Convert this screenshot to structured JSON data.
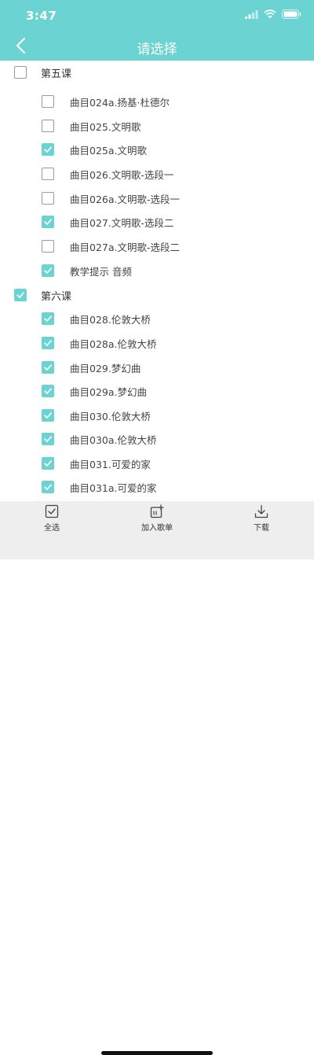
{
  "status_bar": {
    "time": "3:47"
  },
  "nav": {
    "title": "请选择"
  },
  "colors": {
    "accent": "#6cd3d3",
    "toolbar_bg": "#eeeeee"
  },
  "rows": [
    {
      "type": "group",
      "label": "第五课",
      "checked": false
    },
    {
      "type": "item",
      "label": "曲目024a.扬基·杜德尔",
      "checked": false
    },
    {
      "type": "item",
      "label": "曲目025.文明歌",
      "checked": false
    },
    {
      "type": "item",
      "label": "曲目025a.文明歌",
      "checked": true
    },
    {
      "type": "item",
      "label": "曲目026.文明歌-选段一",
      "checked": false
    },
    {
      "type": "item",
      "label": "曲目026a.文明歌-选段一",
      "checked": false
    },
    {
      "type": "item",
      "label": "曲目027.文明歌-选段二",
      "checked": true
    },
    {
      "type": "item",
      "label": "曲目027a.文明歌-选段二",
      "checked": false
    },
    {
      "type": "item",
      "label": "教学提示 音频",
      "checked": true
    },
    {
      "type": "group",
      "label": "第六课",
      "checked": true
    },
    {
      "type": "item",
      "label": "曲目028.伦敦大桥",
      "checked": true
    },
    {
      "type": "item",
      "label": "曲目028a.伦敦大桥",
      "checked": true
    },
    {
      "type": "item",
      "label": "曲目029.梦幻曲",
      "checked": true
    },
    {
      "type": "item",
      "label": "曲目029a.梦幻曲",
      "checked": true
    },
    {
      "type": "item",
      "label": "曲目030.伦敦大桥",
      "checked": true
    },
    {
      "type": "item",
      "label": "曲目030a.伦敦大桥",
      "checked": true
    },
    {
      "type": "item",
      "label": "曲目031.可爱的家",
      "checked": true
    },
    {
      "type": "item",
      "label": "曲目031a.可爱的家",
      "checked": true
    }
  ],
  "toolbar": {
    "select_all": {
      "label": "全选",
      "icon": "select-all-icon"
    },
    "add_to_playlist": {
      "label": "加入歌单",
      "icon": "add-playlist-icon"
    },
    "download": {
      "label": "下载",
      "icon": "download-icon"
    }
  }
}
